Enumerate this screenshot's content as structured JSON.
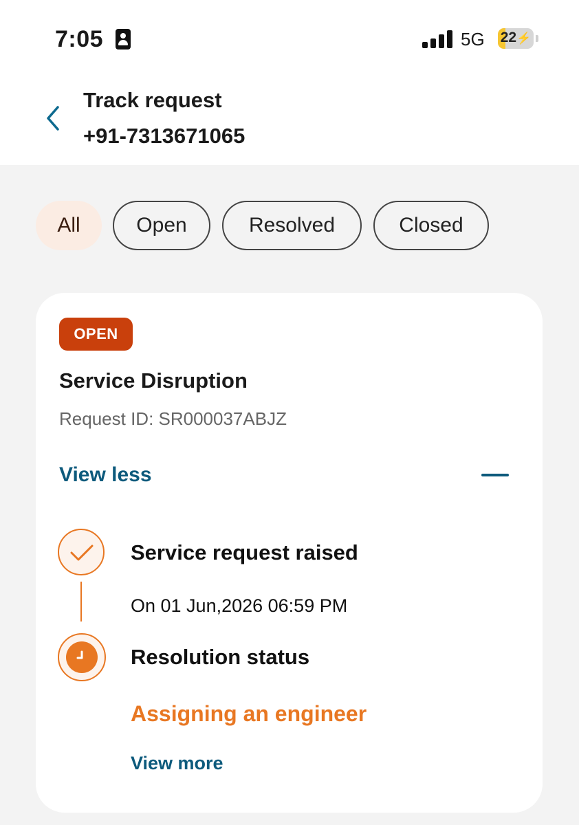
{
  "status_bar": {
    "time": "7:05",
    "network": "5G",
    "battery_level": "22",
    "battery_fraction": 0.22,
    "battery_color": "#f7c631",
    "icons": [
      "portrait-lock-icon",
      "signal-icon",
      "battery-charging-icon"
    ]
  },
  "header": {
    "title": "Track request",
    "phone": "+91-7313671065",
    "back_icon": "chevron-left-icon"
  },
  "filters": [
    {
      "label": "All",
      "active": true
    },
    {
      "label": "Open",
      "active": false
    },
    {
      "label": "Resolved",
      "active": false
    },
    {
      "label": "Closed",
      "active": false
    }
  ],
  "request": {
    "status_badge": "OPEN",
    "title": "Service Disruption",
    "request_id": "Request ID: SR000037ABJZ",
    "toggle_label": "View less",
    "toggle_icon": "minus-icon",
    "timeline": [
      {
        "title": "Service request raised",
        "detail": "On 01 Jun,2026 06:59 PM",
        "icon": "check-icon"
      },
      {
        "title": "Resolution status",
        "detail": "Assigning an engineer",
        "icon": "clock-icon"
      }
    ],
    "view_more_label": "View more"
  },
  "colors": {
    "accent_orange": "#e87722",
    "badge_red": "#c9400c",
    "link_blue": "#0d5a7c",
    "chip_active_bg": "#fbece3",
    "page_bg": "#f3f3f3"
  }
}
